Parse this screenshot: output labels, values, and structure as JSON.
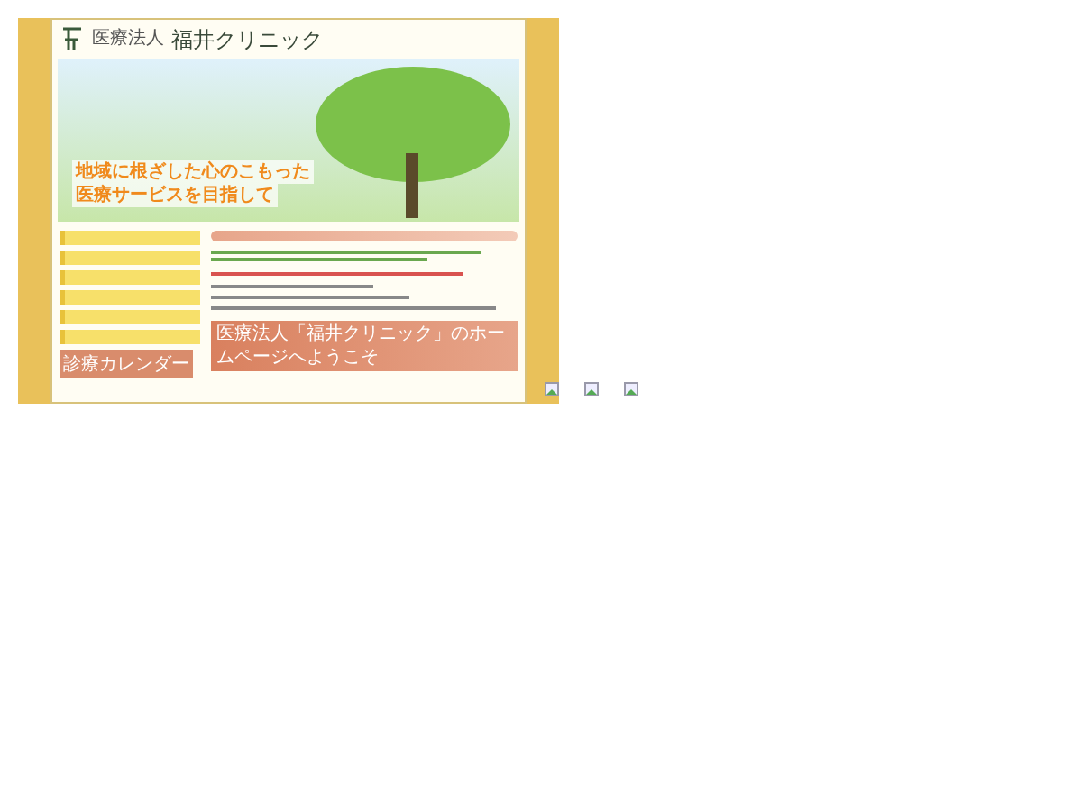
{
  "header": {
    "org": "医療法人",
    "name": "福井クリニック"
  },
  "banner": {
    "slogan": [
      "地域に根ざした心のこもった",
      "医療サービスを目指して"
    ]
  },
  "sidebar": {
    "calendar_title": "診療カレンダー"
  },
  "welcome": {
    "title": "医療法人「福井クリニック」のホームページへようこそ"
  }
}
